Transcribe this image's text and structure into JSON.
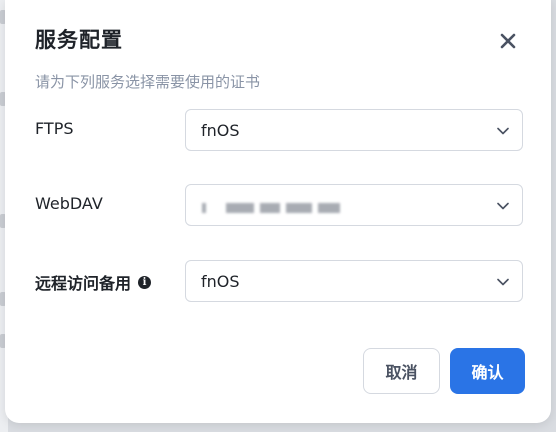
{
  "dialog": {
    "title": "服务配置",
    "subtitle": "请为下列服务选择需要使用的证书",
    "close_icon": "close-icon"
  },
  "rows": [
    {
      "label": "FTPS",
      "value": "fnOS",
      "value_obscured": false
    },
    {
      "label": "WebDAV",
      "value": "",
      "value_obscured": true
    },
    {
      "label": "远程访问备用",
      "value": "fnOS",
      "value_obscured": false,
      "has_info_icon": true
    }
  ],
  "buttons": {
    "cancel_label": "取消",
    "confirm_label": "确认"
  },
  "colors": {
    "accent": "#2a74e6",
    "title": "#1f2329",
    "subtitle": "#8a94a6",
    "border": "#d5d9e0"
  }
}
